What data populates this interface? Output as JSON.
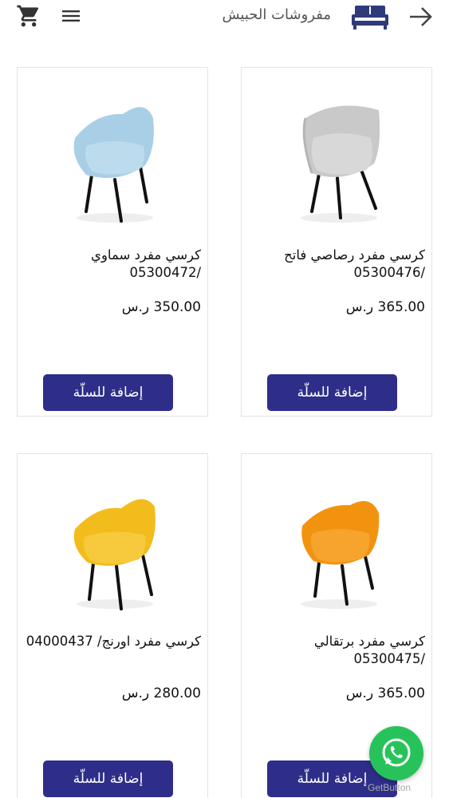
{
  "header": {
    "store_name": "مفروشات الحبيش",
    "icons": [
      "cart-icon",
      "menu-icon",
      "sofa-logo-icon",
      "back-arrow-icon"
    ]
  },
  "products": [
    {
      "name": "كرسي مفرد رصاصي فاتح /05300476",
      "price": "365.00 ر.س",
      "button": "إضافة للسلّة",
      "color": "#c9c9c9"
    },
    {
      "name": "كرسي مفرد سماوي /05300472",
      "price": "350.00 ر.س",
      "button": "إضافة للسلّة",
      "color": "#a9cfe6"
    },
    {
      "name": "كرسي مفرد برتقالي /05300475",
      "price": "365.00 ر.س",
      "button": "إضافة للسلّة",
      "color": "#f2930f"
    },
    {
      "name": "كرسي مفرد اورنج/ 04000437",
      "price": "280.00 ر.س",
      "button": "إضافة للسلّة",
      "color": "#f2bd1c"
    }
  ],
  "widget": {
    "label": "GetButton",
    "icon": "whatsapp-icon"
  },
  "colors": {
    "button_bg": "#2e2e8a",
    "whatsapp_green": "#27c35a"
  }
}
